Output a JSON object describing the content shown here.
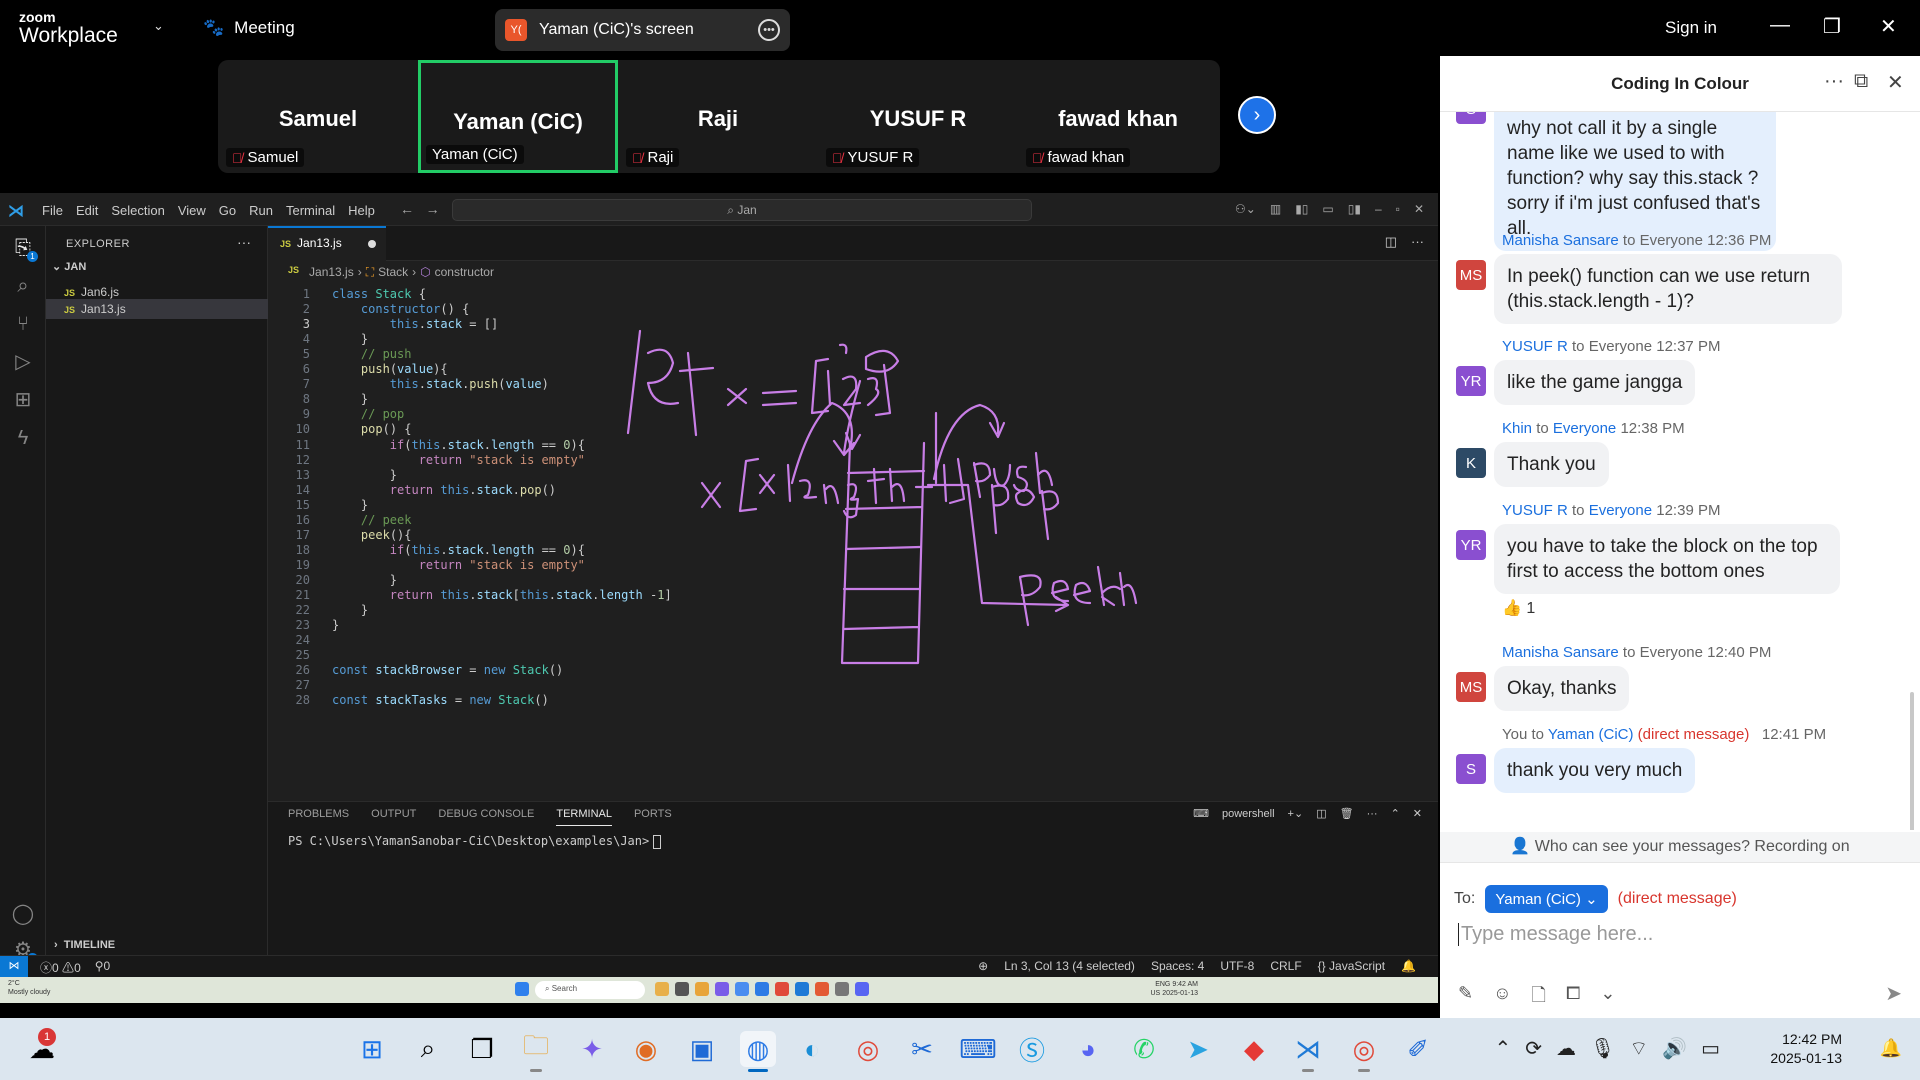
{
  "zoom": {
    "logo_line1": "zoom",
    "logo_line2": "Workplace",
    "meeting_label": "Meeting",
    "share_label": "Yaman (CiC)'s screen",
    "share_avatar": "Y(",
    "sign_in": "Sign in",
    "participants": [
      {
        "name": "Samuel",
        "label": "Samuel",
        "muted": true
      },
      {
        "name": "Yaman (CiC)",
        "label": "Yaman (CiC)",
        "muted": false,
        "active": true
      },
      {
        "name": "Raji",
        "label": "Raji",
        "muted": true
      },
      {
        "name": "YUSUF R",
        "label": "YUSUF R",
        "muted": true
      },
      {
        "name": "fawad khan",
        "label": "fawad khan",
        "muted": true
      }
    ]
  },
  "vscode": {
    "menu": [
      "File",
      "Edit",
      "Selection",
      "View",
      "Go",
      "Run",
      "Terminal",
      "Help"
    ],
    "search": "Jan",
    "explorer_title": "EXPLORER",
    "folder": "JAN",
    "files": [
      "Jan6.js",
      "Jan13.js"
    ],
    "timeline": "TIMELINE",
    "tab": "Jan13.js",
    "breadcrumb": [
      "Jan13.js",
      "Stack",
      "constructor"
    ],
    "lines": [
      "class Stack {",
      "    constructor() {",
      "        this.stack = []",
      "    }",
      "    // push",
      "    push(value){",
      "        this.stack.push(value)",
      "    }",
      "    // pop",
      "    pop() {",
      "        if(this.stack.length == 0){",
      "            return \"stack is empty\"",
      "        }",
      "        return this.stack.pop()",
      "    }",
      "    // peek",
      "    peek(){",
      "        if(this.stack.length == 0){",
      "            return \"stack is empty\"",
      "        }",
      "        return this.stack[this.stack.length -1]",
      "    }",
      "}",
      "",
      "",
      "const stackBrowser = new Stack()",
      "",
      "const stackTasks = new Stack()"
    ],
    "panel_tabs": [
      "PROBLEMS",
      "OUTPUT",
      "DEBUG CONSOLE",
      "TERMINAL",
      "PORTS"
    ],
    "shell": "powershell",
    "prompt": "PS C:\\Users\\YamanSanobar-CiC\\Desktop\\examples\\Jan>",
    "status": {
      "errors": "0",
      "warnings": "0",
      "ports": "0",
      "cursor": "Ln 3, Col 13 (4 selected)",
      "spaces": "Spaces: 4",
      "encoding": "UTF-8",
      "eol": "CRLF",
      "language": "JavaScript"
    }
  },
  "inner_taskbar": {
    "weather_temp": "2°C",
    "weather_desc": "Mostly cloudy",
    "search": "Search",
    "time": "9:42 AM",
    "date": "2025-01-13",
    "lang1": "ENG",
    "lang2": "US"
  },
  "chat": {
    "title": "Coding In Colour",
    "messages": [
      {
        "avatar": "S",
        "avatar_color": "#8a4fd0",
        "text": "why not call it by a single name like we used to with function? why say this.stack ? sorry if i'm just confused that's all.",
        "mine": true
      },
      {
        "sender": "Manisha Sansare",
        "to": "to Everyone",
        "time": "12:36 PM",
        "avatar": "MS",
        "avatar_color": "#d0453e",
        "text": "In peek() function  can we use return (this.stack.length - 1)?"
      },
      {
        "sender": "YUSUF R",
        "to": "to Everyone",
        "time": "12:37 PM",
        "avatar": "YR",
        "avatar_color": "#8a4fd0",
        "text": "like the game  jangga"
      },
      {
        "sender": "Khin",
        "to": "to",
        "to_name": "Everyone",
        "time": "12:38 PM",
        "avatar": "K",
        "avatar_color": "#2d4a66",
        "text": "Thank you"
      },
      {
        "sender": "YUSUF R",
        "to": "to",
        "to_name": "Everyone",
        "time": "12:39 PM",
        "avatar": "YR",
        "avatar_color": "#8a4fd0",
        "text": "you have to take the block on the top first to access the bottom ones",
        "reaction": "👍 1"
      },
      {
        "sender": "Manisha Sansare",
        "to": "to Everyone",
        "time": "12:40 PM",
        "avatar": "MS",
        "avatar_color": "#d0453e",
        "text": "Okay, thanks"
      },
      {
        "sender": "You to",
        "to_name": "Yaman (CiC)",
        "dm": "(direct message)",
        "time": "12:41 PM",
        "avatar": "S",
        "avatar_color": "#8a4fd0",
        "text": "thank you very much",
        "mine": true
      }
    ],
    "who_can_see": "Who can see your messages? Recording on",
    "to_label": "To:",
    "to_recipient": "Yaman (CiC)",
    "to_dm": "(direct message)",
    "placeholder": "Type message here..."
  },
  "taskbar": {
    "time": "12:42 PM",
    "date": "2025-01-13",
    "notification_badge": "1"
  }
}
